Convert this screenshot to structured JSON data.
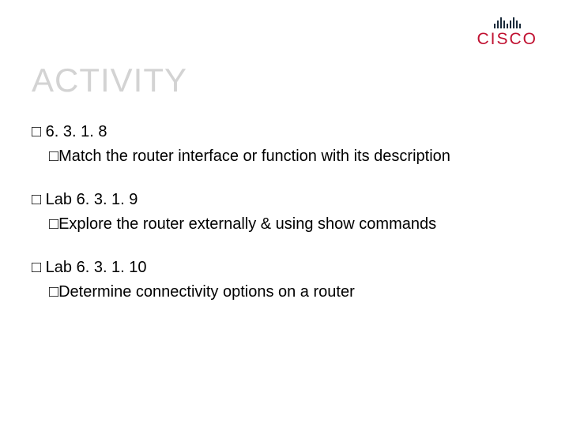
{
  "logo": {
    "brand": "CISCO"
  },
  "title": "ACTIVITY",
  "bullet": "□",
  "items": [
    {
      "l1": "6. 3. 1. 8",
      "l2": "Match the router interface or function with its description"
    },
    {
      "l1": "Lab 6. 3. 1. 9",
      "l2": "Explore the router externally & using show commands"
    },
    {
      "l1": "Lab 6. 3. 1. 10",
      "l2": "Determine connectivity options on a router"
    }
  ]
}
